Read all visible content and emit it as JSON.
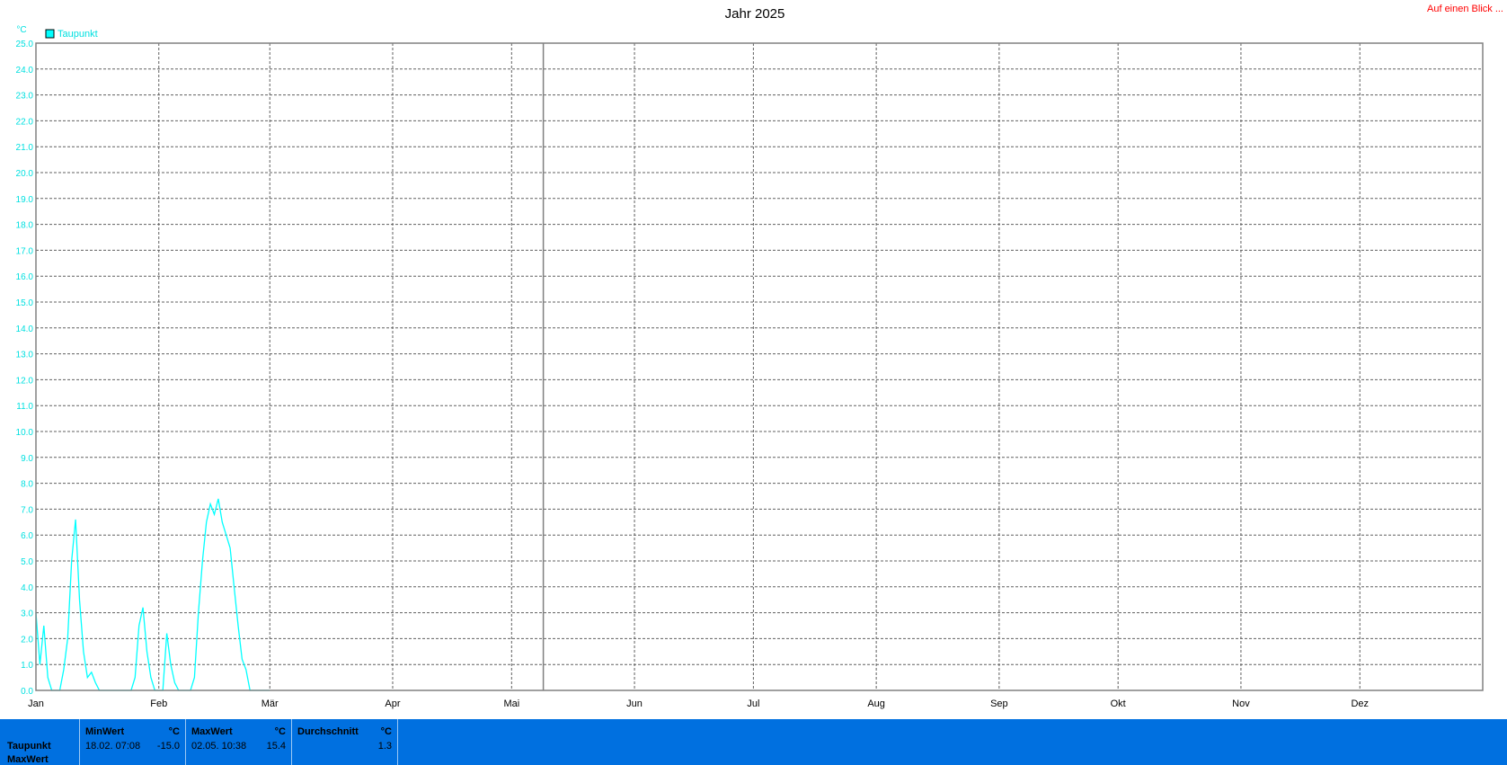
{
  "header": {
    "link_label": "Auf einen Blick ..."
  },
  "chart_data": {
    "type": "line",
    "title": "Jahr 2025",
    "ylabel": "°C",
    "ylim": [
      0,
      25
    ],
    "yticks": [
      "0.0",
      "1.0",
      "2.0",
      "3.0",
      "4.0",
      "5.0",
      "6.0",
      "7.0",
      "8.0",
      "9.0",
      "10.0",
      "11.0",
      "12.0",
      "13.0",
      "14.0",
      "15.0",
      "16.0",
      "17.0",
      "18.0",
      "19.0",
      "20.0",
      "21.0",
      "22.0",
      "23.0",
      "24.0",
      "25.0"
    ],
    "x_unit": "day of year",
    "xlim": [
      0,
      365
    ],
    "month_labels": [
      "Jan",
      "Feb",
      "Mär",
      "Apr",
      "Mai",
      "Jun",
      "Jul",
      "Aug",
      "Sep",
      "Okt",
      "Nov",
      "Dez"
    ],
    "month_starts": [
      0,
      31,
      59,
      90,
      120,
      151,
      181,
      212,
      243,
      273,
      304,
      334
    ],
    "current_day": 128,
    "grid": true,
    "legend": [
      {
        "name": "Taupunkt",
        "color": "#00ffff",
        "position": "top-left"
      }
    ],
    "series": [
      {
        "name": "Taupunkt Max",
        "role": "max",
        "points": [
          [
            0,
            3.0
          ],
          [
            1,
            1.0
          ],
          [
            2,
            2.5
          ],
          [
            3,
            0.5
          ],
          [
            4,
            0
          ],
          [
            5,
            0
          ],
          [
            6,
            0
          ],
          [
            7,
            0.8
          ],
          [
            8,
            2.0
          ],
          [
            9,
            5.0
          ],
          [
            10,
            6.6
          ],
          [
            11,
            3.5
          ],
          [
            12,
            1.5
          ],
          [
            13,
            0.5
          ],
          [
            14,
            0.7
          ],
          [
            15,
            0.3
          ],
          [
            16,
            0
          ],
          [
            17,
            0
          ],
          [
            18,
            0
          ],
          [
            19,
            0
          ],
          [
            20,
            0
          ],
          [
            21,
            0
          ],
          [
            22,
            0
          ],
          [
            23,
            0
          ],
          [
            24,
            0
          ],
          [
            25,
            0.5
          ],
          [
            26,
            2.5
          ],
          [
            27,
            3.2
          ],
          [
            28,
            1.5
          ],
          [
            29,
            0.5
          ],
          [
            30,
            0
          ],
          [
            31,
            0
          ],
          [
            32,
            0
          ],
          [
            33,
            2.2
          ],
          [
            34,
            1.0
          ],
          [
            35,
            0.3
          ],
          [
            36,
            0
          ],
          [
            37,
            0
          ],
          [
            38,
            0
          ],
          [
            39,
            0
          ],
          [
            40,
            0.5
          ],
          [
            41,
            3.0
          ],
          [
            42,
            5.0
          ],
          [
            43,
            6.5
          ],
          [
            44,
            7.2
          ],
          [
            45,
            6.8
          ],
          [
            46,
            7.4
          ],
          [
            47,
            6.5
          ],
          [
            48,
            6.0
          ],
          [
            49,
            5.5
          ],
          [
            50,
            4.0
          ],
          [
            51,
            2.5
          ],
          [
            52,
            1.2
          ],
          [
            53,
            0.8
          ],
          [
            54,
            0
          ],
          [
            55,
            0
          ],
          [
            56,
            0
          ],
          [
            57,
            0
          ],
          [
            58,
            0
          ],
          [
            59,
            0
          ]
        ],
        "note_ignore": false
      }
    ]
  },
  "stats": {
    "row_label_1": "Taupunkt",
    "row_label_2": "MaxWert",
    "columns": [
      {
        "header": "MinWert",
        "unit": "°C",
        "date": "18.02.  07:08",
        "value": "-15.0"
      },
      {
        "header": "MaxWert",
        "unit": "°C",
        "date": "02.05.  10:38",
        "value": "15.4"
      },
      {
        "header": "Durchschnitt",
        "unit": "°C",
        "date": "",
        "value": "1.3"
      }
    ]
  }
}
